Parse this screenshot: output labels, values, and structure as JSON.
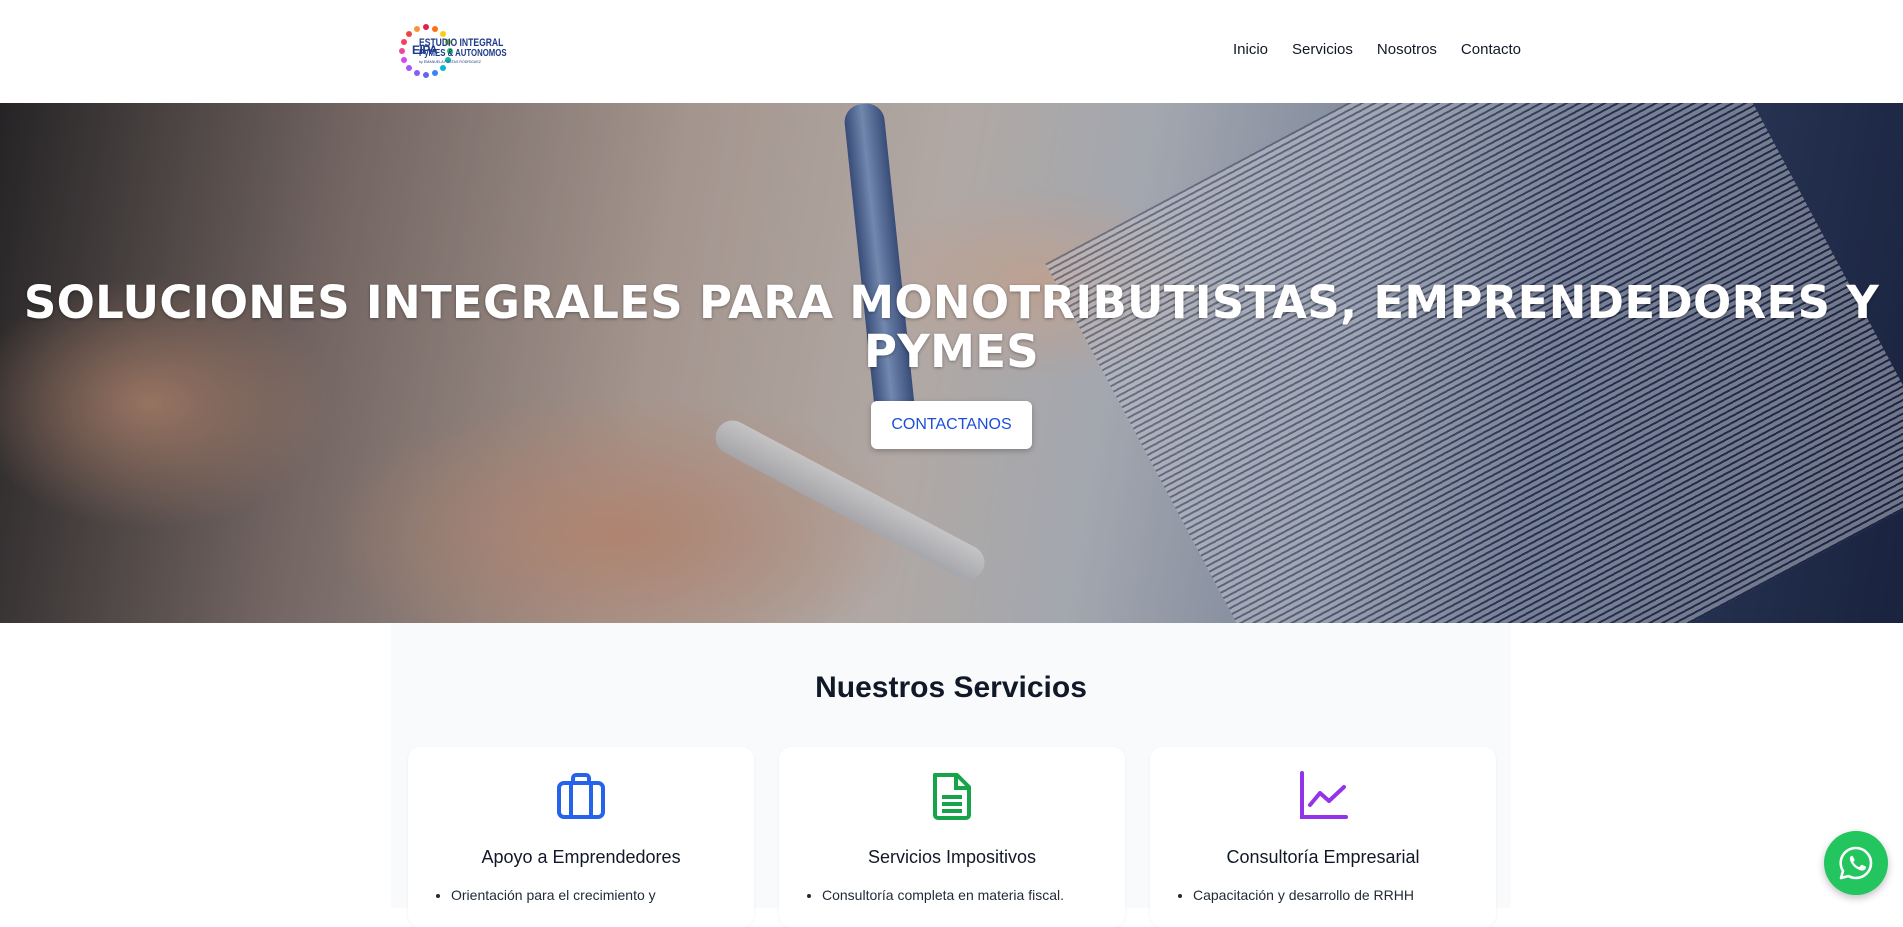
{
  "header": {
    "logo": {
      "initials": "EIPA",
      "line1": "ESTUDIO INTEGRAL",
      "line2": "PyMES & AUTONOMOS",
      "line3": "by EMANUELA FUSTAS RODRIGUEZ"
    },
    "nav": [
      {
        "label": "Inicio"
      },
      {
        "label": "Servicios"
      },
      {
        "label": "Nosotros"
      },
      {
        "label": "Contacto"
      }
    ]
  },
  "hero": {
    "title_line1": "SOLUCIONES INTEGRALES PARA MONOTRIBUTISTAS, EMPRENDEDORES Y",
    "title_line2": "PYMES",
    "cta_label": "CONTACTANOS"
  },
  "services": {
    "title": "Nuestros Servicios",
    "cards": [
      {
        "icon": "briefcase-icon",
        "title": "Apoyo a Emprendedores",
        "item": "Orientación para el crecimiento y",
        "color": "#2563eb"
      },
      {
        "icon": "file-text-icon",
        "title": "Servicios Impositivos",
        "item": "Consultoría completa en materia fiscal.",
        "color": "#16a34a"
      },
      {
        "icon": "chart-line-icon",
        "title": "Consultoría Empresarial",
        "item": "Capacitación y desarrollo de RRHH",
        "color": "#9333ea"
      }
    ]
  },
  "whatsapp": {
    "icon": "whatsapp-icon",
    "color": "#22c55e"
  }
}
